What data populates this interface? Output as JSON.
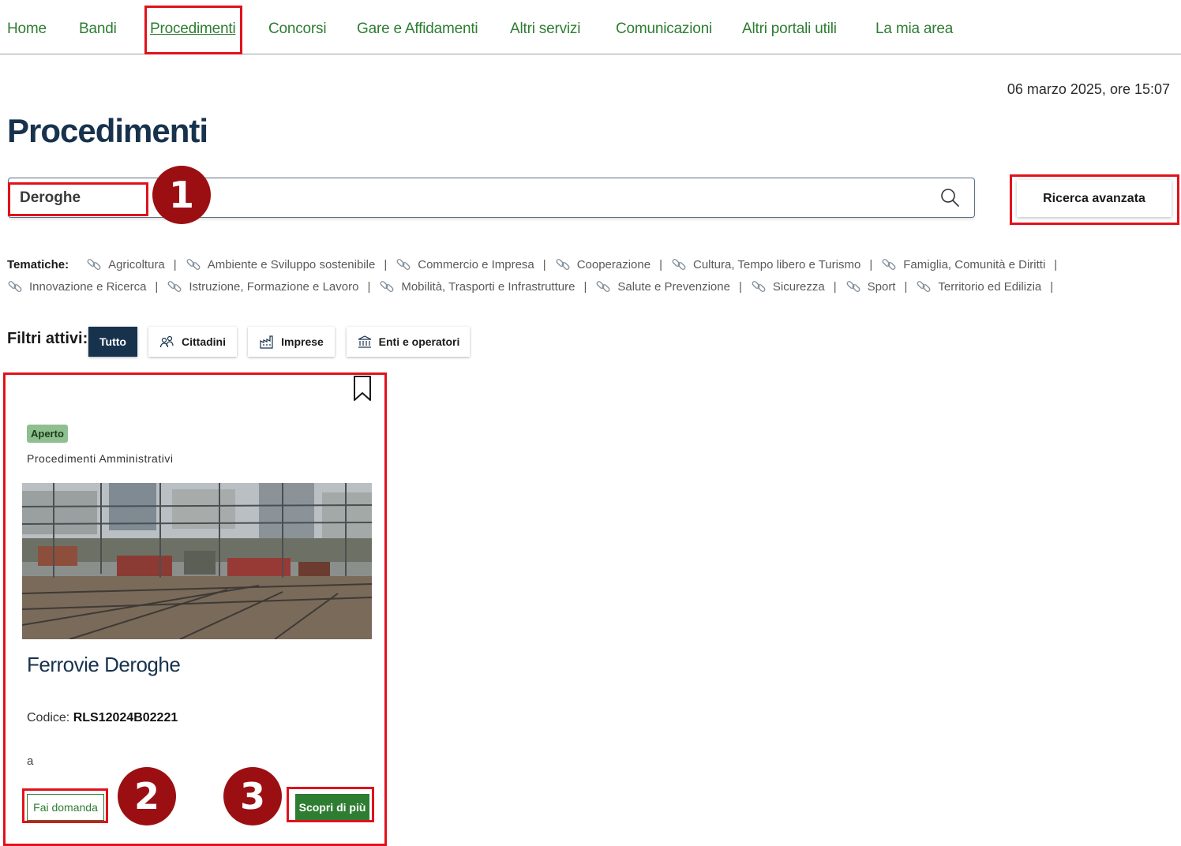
{
  "nav": {
    "items": [
      {
        "label": "Home"
      },
      {
        "label": "Bandi"
      },
      {
        "label": "Procedimenti",
        "active": true
      },
      {
        "label": "Concorsi"
      },
      {
        "label": "Gare e Affidamenti"
      },
      {
        "label": "Altri servizi"
      },
      {
        "label": "Comunicazioni"
      },
      {
        "label": "Altri portali utili"
      },
      {
        "label": "La mia area"
      }
    ]
  },
  "header": {
    "date": "06 marzo 2025, ore 15:07",
    "title": "Procedimenti"
  },
  "search": {
    "value": "Deroghe",
    "icon": "search-icon"
  },
  "advanced_search": {
    "label": "Ricerca avanzata"
  },
  "tematiche": {
    "label": "Tematiche:",
    "icon": "link-icon",
    "row1": [
      "Agricoltura",
      "Ambiente e Sviluppo sostenibile",
      "Commercio e Impresa",
      "Cooperazione",
      "Cultura, Tempo libero e Turismo",
      "Famiglia, Comunità e Diritti"
    ],
    "row2": [
      "Innovazione e Ricerca",
      "Istruzione, Formazione e Lavoro",
      "Mobilità, Trasporti e Infrastrutture",
      "Salute e Prevenzione",
      "Sicurezza",
      "Sport",
      "Territorio ed Edilizia"
    ],
    "separator": "|"
  },
  "filters": {
    "label": "Filtri attivi:",
    "items": [
      {
        "label": "Tutto",
        "active": true
      },
      {
        "label": "Cittadini",
        "icon": "people-icon"
      },
      {
        "label": "Imprese",
        "icon": "factory-icon"
      },
      {
        "label": "Enti e operatori",
        "icon": "institution-icon"
      }
    ]
  },
  "card": {
    "status": "Aperto",
    "category": "Procedimenti Amministrativi",
    "image": "railway-photo",
    "title": "Ferrovie Deroghe",
    "code_label": "Codice:",
    "code": "RLS12024B02221",
    "description": "a",
    "apply_label": "Fai domanda",
    "more_label": "Scopri di più"
  },
  "annotations": {
    "markers": [
      "1",
      "2",
      "3"
    ]
  },
  "colors": {
    "accent_green": "#2e7d32",
    "navy": "#17324d",
    "highlight_red": "#e0121b",
    "marker_red": "#9b0f12",
    "badge_green": "#8fbf8f"
  }
}
